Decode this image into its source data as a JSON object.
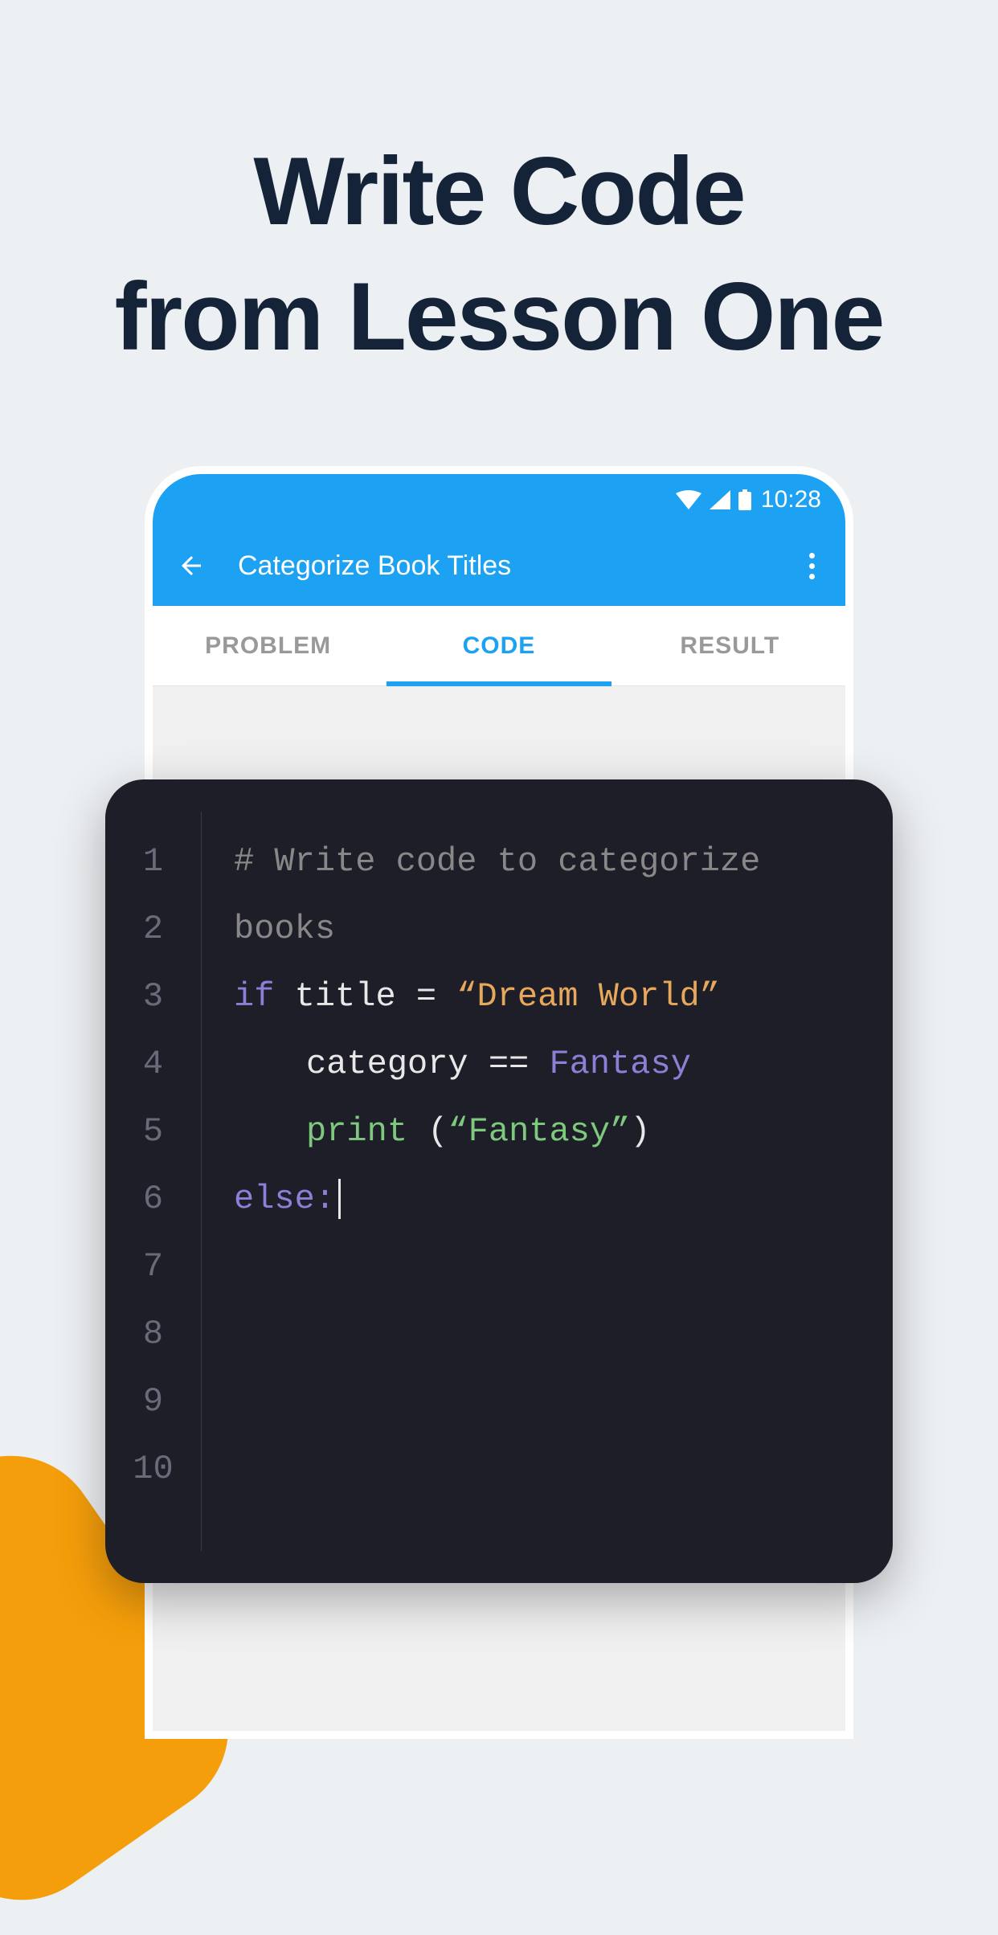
{
  "headline_line1": "Write Code",
  "headline_line2": "from Lesson One",
  "status": {
    "time": "10:28"
  },
  "appbar": {
    "title": "Categorize Book Titles"
  },
  "tabs": {
    "problem": "PROBLEM",
    "code": "CODE",
    "result": "RESULT"
  },
  "editor": {
    "line_numbers": [
      "1",
      "2",
      "3",
      "4",
      "5",
      "6",
      "7",
      "8",
      "9",
      "10"
    ],
    "lines": {
      "l1_comment": "# Write code to categorize books",
      "l3_if": "if",
      "l3_title": " title ",
      "l3_eq": "=",
      "l3_str": " “Dream World”",
      "l4_cat": "category ",
      "l4_op": "==",
      "l4_fantasy": " Fantasy",
      "l5_print": "print ",
      "l5_lp": "(",
      "l5_str": "“Fantasy”",
      "l5_rp": ")",
      "l6_else": "else:"
    }
  }
}
